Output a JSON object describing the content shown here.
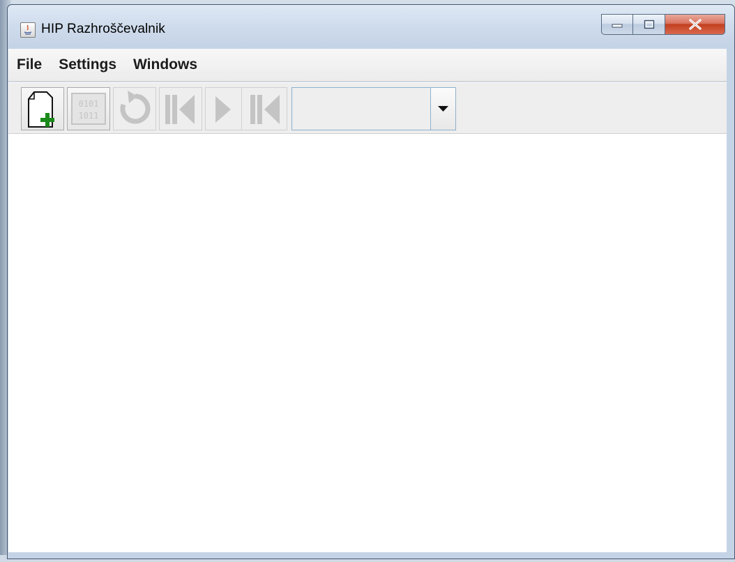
{
  "window": {
    "title": "HIP Razhroščevalnik"
  },
  "menu": {
    "items": [
      "File",
      "Settings",
      "Windows"
    ]
  },
  "toolbar": {
    "binary_icon_text": [
      "0101",
      "1011"
    ],
    "combo_value": ""
  },
  "colors": {
    "close_button": "#c2401f",
    "new_file_plus": "#1a8a1a",
    "disabled_icon": "#c4c4c4"
  },
  "icons": {
    "new_file": "new-file-icon",
    "binary": "binary-icon",
    "reset": "reset-icon",
    "step_back": "step-back-icon",
    "run": "run-icon",
    "step_forward": "step-forward-icon",
    "dropdown": "chevron-down-icon"
  }
}
